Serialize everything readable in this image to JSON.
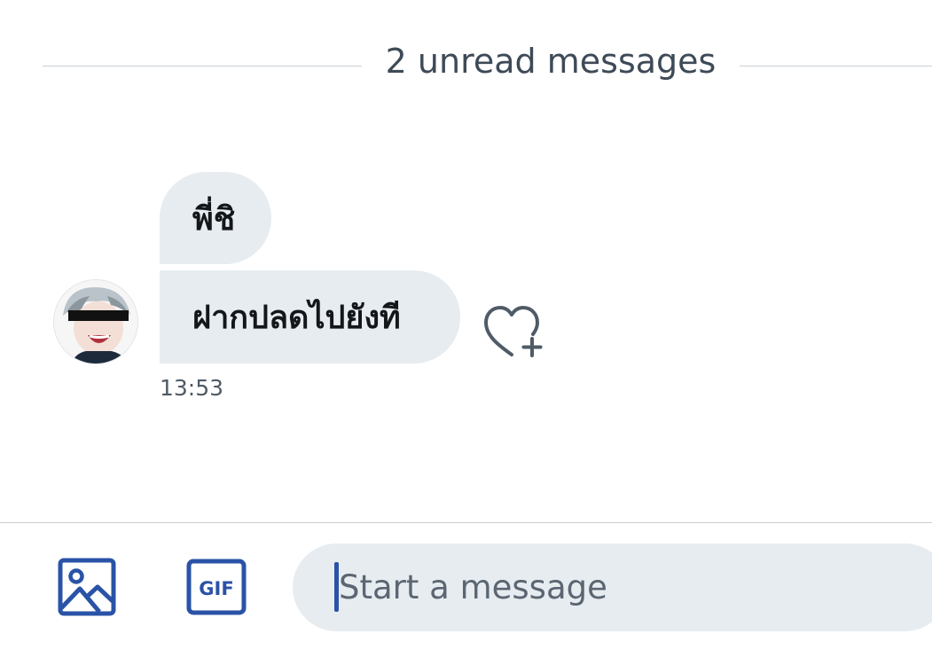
{
  "conversation": {
    "unread_divider": "2 unread messages",
    "messages": [
      {
        "text": "พี่ชิ"
      },
      {
        "text": "ฝากปลดไปยังที"
      }
    ],
    "timestamp": "13:53"
  },
  "composer": {
    "placeholder": "Start a message",
    "media_icon": "image-icon",
    "gif_label": "GIF"
  },
  "colors": {
    "accent": "#2a53a7",
    "bubble": "#e7ecf0",
    "text": "#14171a",
    "muted": "#4f5a66"
  }
}
